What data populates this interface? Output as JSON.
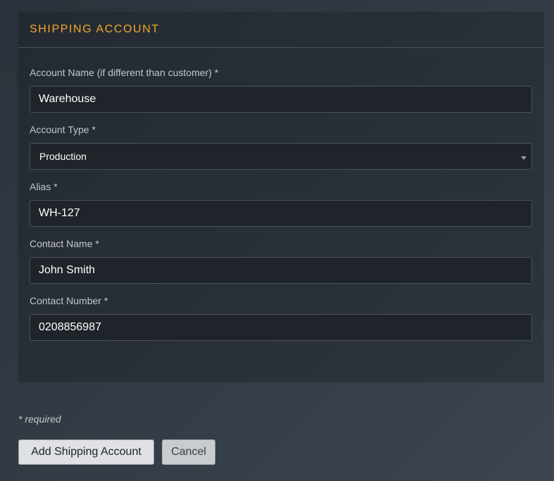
{
  "panel": {
    "title": "SHIPPING ACCOUNT"
  },
  "fields": {
    "account_name": {
      "label": "Account Name (if different than customer) *",
      "value": "Warehouse"
    },
    "account_type": {
      "label": "Account Type *",
      "value": "Production",
      "icon": "chevron-down-icon"
    },
    "alias": {
      "label": "Alias *",
      "value": "WH-127"
    },
    "contact_name": {
      "label": "Contact Name *",
      "value": "John Smith"
    },
    "contact_number": {
      "label": "Contact Number *",
      "value": "0208856987"
    }
  },
  "required_note": "* required",
  "actions": {
    "submit_label": "Add Shipping Account",
    "cancel_label": "Cancel"
  },
  "colors": {
    "accent": "#f2a72c",
    "panel_bg": "#262c33",
    "input_bg": "#1f242a"
  }
}
